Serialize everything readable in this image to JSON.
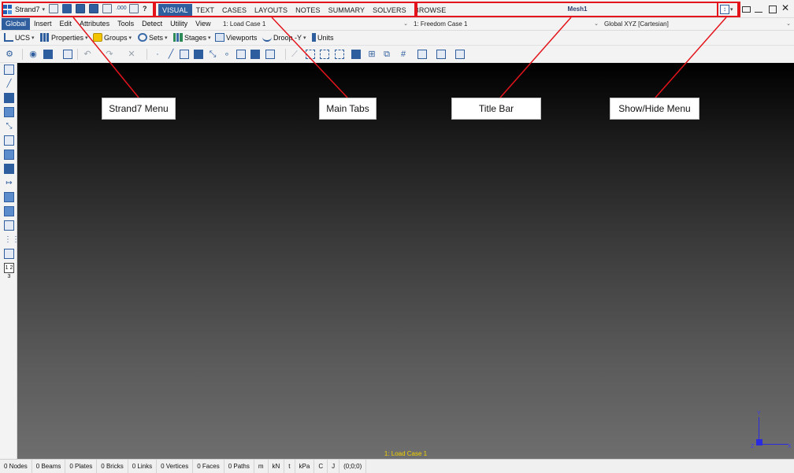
{
  "app": {
    "name": "Strand7",
    "window_title": "Mesh1"
  },
  "main_tabs": [
    "VISUAL",
    "TEXT",
    "CASES",
    "LAYOUTS",
    "NOTES",
    "SUMMARY",
    "SOLVERS",
    "BROWSE"
  ],
  "menu": [
    "Global",
    "Insert",
    "Edit",
    "Attributes",
    "Tools",
    "Detect",
    "Utility",
    "View"
  ],
  "combos": {
    "load_case": "1: Load Case 1",
    "freedom_case": "1: Freedom Case 1",
    "coord_system": "Global XYZ [Cartesian]"
  },
  "toolbar1": {
    "ucs": "UCS",
    "properties": "Properties",
    "groups": "Groups",
    "sets": "Sets",
    "stages": "Stages",
    "viewports": "Viewports",
    "droop": "Droop -Y",
    "units": "Units"
  },
  "quick_icons": {
    "numbering": ".000",
    "help": "?"
  },
  "viewport": {
    "case_label": "1: Load Case 1",
    "axes": {
      "y": "Y",
      "z": "Z",
      "x": "X"
    }
  },
  "left_tool_label": "1 2 3",
  "status": [
    "0 Nodes",
    "0 Beams",
    "0 Plates",
    "0 Bricks",
    "0 Links",
    "0 Vertices",
    "0 Faces",
    "0 Paths",
    "m",
    "kN",
    "t",
    "kPa",
    "C",
    "J",
    "(0;0;0)"
  ],
  "callouts": {
    "menu": "Strand7 Menu",
    "tabs": "Main Tabs",
    "title": "Title Bar",
    "showhide": "Show/Hide Menu"
  },
  "colors": {
    "accent": "#2f5e9e",
    "callout_line": "#e3141b",
    "case_label": "#f2d100",
    "axis": "#2a2ae0"
  }
}
